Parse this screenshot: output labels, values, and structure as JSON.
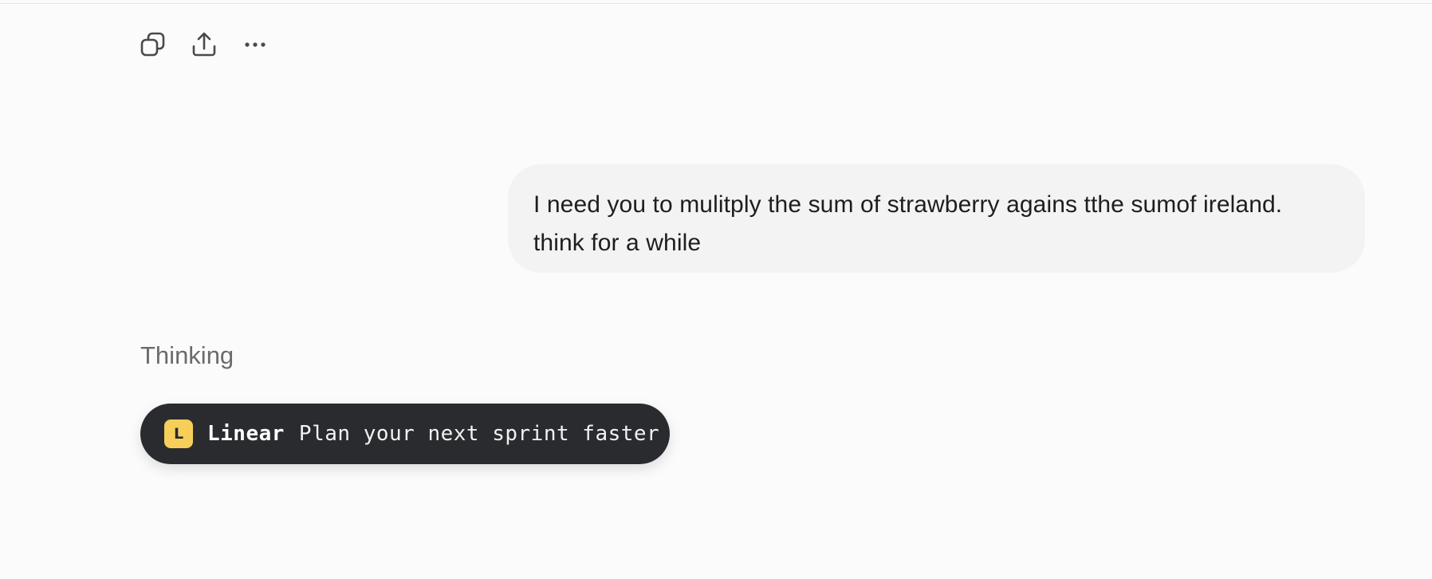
{
  "toolbar": {
    "buttons": [
      {
        "icon": "copy-icon"
      },
      {
        "icon": "share-icon"
      },
      {
        "icon": "more-icon"
      }
    ]
  },
  "conversation": {
    "user_message": "I need you to mulitply the sum of strawberry agains tthe sumof ireland. think for a while",
    "assistant_status": "Thinking"
  },
  "ad": {
    "logo_letter": "L",
    "brand": "Linear",
    "text": "Plan your next sprint faster",
    "logo_color": "#f6cf5a",
    "background_color": "#2a2b2f"
  }
}
